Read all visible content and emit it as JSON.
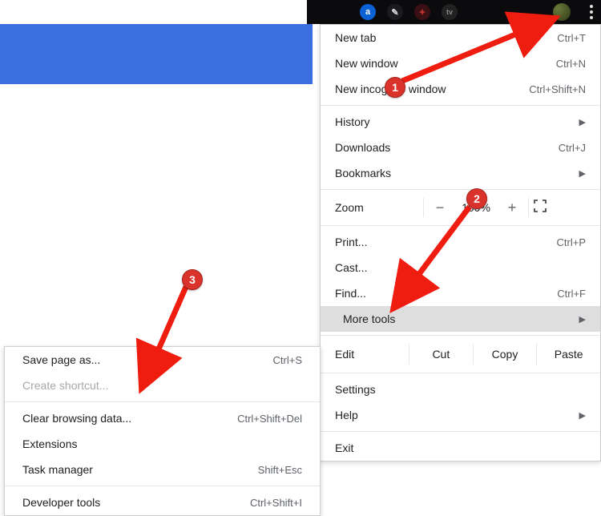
{
  "toolbar": {
    "star": "☆",
    "ext_a": "a",
    "ext_pen": "✎",
    "ext_red": "✦",
    "ext_tv": "tv"
  },
  "menu": {
    "new_tab": {
      "label": "New tab",
      "shortcut": "Ctrl+T"
    },
    "new_window": {
      "label": "New window",
      "shortcut": "Ctrl+N"
    },
    "new_incognito": {
      "label": "New incognito window",
      "shortcut": "Ctrl+Shift+N"
    },
    "history": {
      "label": "History"
    },
    "downloads": {
      "label": "Downloads",
      "shortcut": "Ctrl+J"
    },
    "bookmarks": {
      "label": "Bookmarks"
    },
    "zoom": {
      "label": "Zoom",
      "minus": "−",
      "value": "100%",
      "plus": "+"
    },
    "print": {
      "label": "Print...",
      "shortcut": "Ctrl+P"
    },
    "cast": {
      "label": "Cast..."
    },
    "find": {
      "label": "Find...",
      "shortcut": "Ctrl+F"
    },
    "more_tools": {
      "label": "More tools"
    },
    "edit": {
      "label": "Edit",
      "cut": "Cut",
      "copy": "Copy",
      "paste": "Paste"
    },
    "settings": {
      "label": "Settings"
    },
    "help": {
      "label": "Help"
    },
    "exit": {
      "label": "Exit"
    }
  },
  "submenu": {
    "save_page": {
      "label": "Save page as...",
      "shortcut": "Ctrl+S"
    },
    "create_shortcut": {
      "label": "Create shortcut..."
    },
    "clear_browsing": {
      "label": "Clear browsing data...",
      "shortcut": "Ctrl+Shift+Del"
    },
    "extensions": {
      "label": "Extensions"
    },
    "task_manager": {
      "label": "Task manager",
      "shortcut": "Shift+Esc"
    },
    "dev_tools": {
      "label": "Developer tools",
      "shortcut": "Ctrl+Shift+I"
    }
  },
  "annotations": {
    "b1": "1",
    "b2": "2",
    "b3": "3"
  }
}
